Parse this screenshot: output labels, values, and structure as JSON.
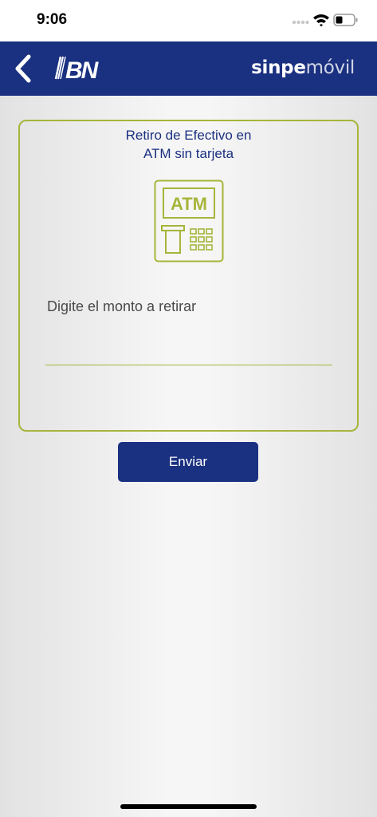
{
  "status_bar": {
    "time": "9:06"
  },
  "nav": {
    "back_icon": "chevron-left-icon",
    "logo_text": "BN",
    "brand_bold": "sinpe",
    "brand_light": "móvil"
  },
  "card": {
    "title_line1": "Retiro de Efectivo en",
    "title_line2": "ATM sin tarjeta",
    "icon_text": "ATM",
    "amount_label": "Digite el monto a retirar",
    "amount_value": ""
  },
  "actions": {
    "send_label": "Enviar"
  },
  "colors": {
    "primary": "#1a3080",
    "accent": "#a6b53a"
  }
}
